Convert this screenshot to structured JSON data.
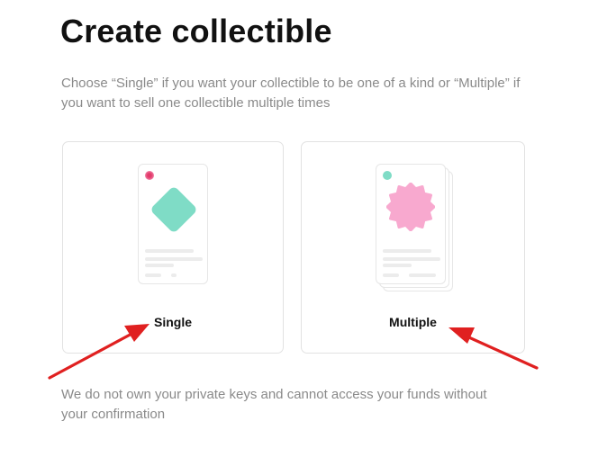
{
  "page": {
    "title": "Create collectible",
    "subtitle": "Choose “Single” if you want your collectible to be one of a kind or “Multiple” if you want to sell one collectible multiple times",
    "footer_note": "We do not own your private keys and cannot access your funds without your confirmation"
  },
  "options": [
    {
      "label": "Single",
      "accent_color": "#7fdcc6",
      "badge_color": "#e23b6b"
    },
    {
      "label": "Multiple",
      "accent_color": "#f8a9cf",
      "badge_color": "#7fdcc6"
    }
  ],
  "annotation": {
    "arrow_color": "#e02020"
  }
}
